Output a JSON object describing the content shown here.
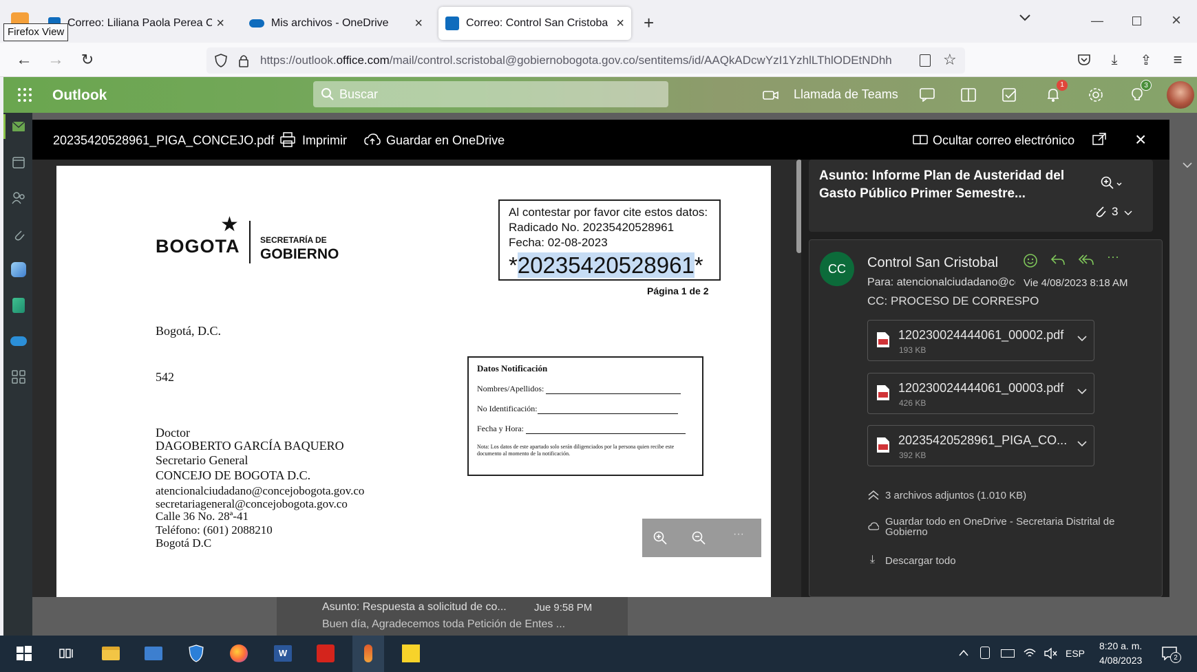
{
  "browser": {
    "tooltip": "Firefox View",
    "tabs": [
      {
        "title": "Correo: Liliana Paola Perea Crist"
      },
      {
        "title": "Mis archivos - OneDrive"
      },
      {
        "title": "Correo: Control San Cristobal -"
      }
    ],
    "url_prefix": "https://outlook.",
    "url_domain": "office.com",
    "url_rest": "/mail/control.scristobal@gobiernobogota.gov.co/sentitems/id/AAQkADcwYzI1YzhlLThlODEtNDhh"
  },
  "outlook": {
    "app_name": "Outlook",
    "search_placeholder": "Buscar",
    "teams_label": "Llamada de Teams",
    "notif_badge": "1",
    "tips_badge": "3"
  },
  "viewer": {
    "filename": "20235420528961_PIGA_CONCEJO.pdf",
    "print_label": "Imprimir",
    "save_label": "Guardar en OneDrive",
    "hide_label": "Ocultar correo electrónico"
  },
  "document": {
    "logo_text": "BOGOTA",
    "secretaria_small": "SECRETARÍA DE",
    "secretaria_big": "GOBIERNO",
    "cite_line1": "Al contestar por favor cite estos datos:",
    "cite_line2": "Radicado No. 20235420528961",
    "cite_line3": "Fecha: 02-08-2023",
    "cite_star1": "*",
    "cite_number": "20235420528961",
    "cite_star2": "*",
    "page_num": "Página 1 de 2",
    "notif_title": "Datos Notificación",
    "notif_names": "Nombres/Apellidos:",
    "notif_id": "No Identificación:",
    "notif_date": "Fecha y Hora:",
    "notif_note": "Nota: Los datos de este apartado solo serán diligenciados por la persona quien recibe este documento al momento de la notificación.",
    "city": "Bogotá, D.C.",
    "code": "542",
    "doctor": "Doctor",
    "name": "DAGOBERTO GARCÍA BAQUERO",
    "role": "Secretario General",
    "org": "CONCEJO DE BOGOTA D.C.",
    "email1": "atencionalciudadano@concejobogota.gov.co",
    "email2": "secretariageneral@concejobogota.gov.co",
    "address": "Calle 36 No. 28ª-41",
    "phone": "Teléfono: (601) 2088210",
    "city2": "Bogotá D.C"
  },
  "email": {
    "subject": "Asunto: Informe Plan de Austeridad del Gasto Público Primer Semestre...",
    "attach_count": "3",
    "avatar": "CC",
    "sender": "Control San Cristobal",
    "to": "Para:  atencionalciudadano@cc",
    "date": "Vie 4/08/2023 8:18 AM",
    "cc": "CC:  PROCESO DE CORRESPO",
    "attachments": [
      {
        "name": "120230024444061_00002.pdf",
        "size": "193 KB"
      },
      {
        "name": "120230024444061_00003.pdf",
        "size": "426 KB"
      },
      {
        "name": "20235420528961_PIGA_CO...",
        "size": "392 KB"
      }
    ],
    "attach_summary": "3 archivos adjuntos (1.010 KB)",
    "save_all": "Guardar todo en OneDrive - Secretaria Distrital de Gobierno",
    "download_all": "Descargar todo"
  },
  "background_list": {
    "subject": "Asunto: Respuesta a solicitud de co...",
    "time": "Jue 9:58 PM",
    "preview": "Buen día, Agradecemos toda Petición de Entes ..."
  },
  "taskbar": {
    "lang": "ESP",
    "time": "8:20 a. m.",
    "date": "4/08/2023",
    "notif_count": "2"
  }
}
